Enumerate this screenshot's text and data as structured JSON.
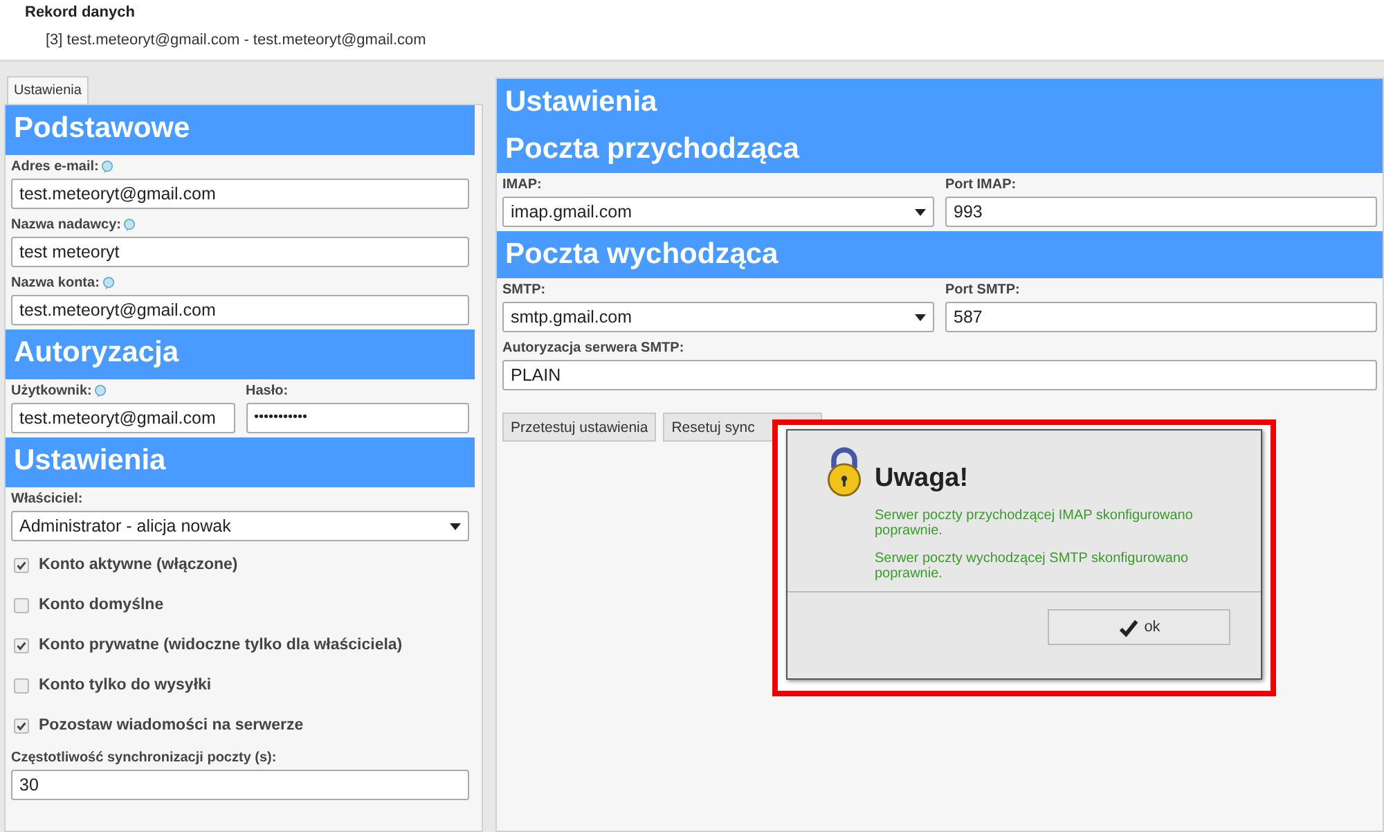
{
  "header": {
    "title": "Rekord danych",
    "subtitle": "[3] test.meteoryt@gmail.com - test.meteoryt@gmail.com"
  },
  "tabs": [
    {
      "label": "Ustawienia",
      "selected": true
    }
  ],
  "left_sections": [
    {
      "title": "Podstawowe",
      "fields": [
        {
          "kind": "text",
          "label": "Adres e-mail:",
          "info": true,
          "value": "test.meteoryt@gmail.com"
        },
        {
          "kind": "text",
          "label": "Nazwa nadawcy:",
          "info": true,
          "value": "test meteoryt"
        },
        {
          "kind": "text",
          "label": "Nazwa konta:",
          "info": true,
          "value": "test.meteoryt@gmail.com"
        }
      ]
    },
    {
      "title": "Autoryzacja",
      "fields": [
        {
          "kind": "pair",
          "items": [
            {
              "kind": "text",
              "label": "Użytkownik:",
              "info": true,
              "value": "test.meteoryt@gmail.com"
            },
            {
              "kind": "password",
              "label": "Hasło:",
              "info": false,
              "value": "•••••••••••"
            }
          ]
        }
      ]
    },
    {
      "title": "Ustawienia",
      "fields": [
        {
          "kind": "select",
          "label": "Właściciel:",
          "info": false,
          "value": "Administrator - alicja nowak"
        },
        {
          "kind": "checkbox",
          "label": "Konto aktywne (włączone)",
          "checked": true
        },
        {
          "kind": "checkbox",
          "label": "Konto domyślne",
          "checked": false
        },
        {
          "kind": "checkbox",
          "label": "Konto prywatne (widoczne tylko dla właściciela)",
          "checked": true
        },
        {
          "kind": "checkbox",
          "label": "Konto tylko do wysyłki",
          "checked": false
        },
        {
          "kind": "checkbox",
          "label": "Pozostaw wiadomości na serwerze",
          "checked": true
        },
        {
          "kind": "text",
          "label": "Częstotliwość synchronizacji poczty (s):",
          "info": false,
          "value": "30"
        }
      ]
    }
  ],
  "right_title": "Ustawienia",
  "right_sections": [
    {
      "title": "Poczta przychodząca",
      "fields": [
        {
          "kind": "pair",
          "items": [
            {
              "kind": "select",
              "label": "IMAP:",
              "info": false,
              "value": "imap.gmail.com"
            },
            {
              "kind": "text",
              "label": "Port IMAP:",
              "info": false,
              "value": "993"
            }
          ]
        }
      ]
    },
    {
      "title": "Poczta wychodząca",
      "fields": [
        {
          "kind": "pair",
          "items": [
            {
              "kind": "select",
              "label": "SMTP:",
              "info": false,
              "value": "smtp.gmail.com"
            },
            {
              "kind": "text",
              "label": "Port SMTP:",
              "info": false,
              "value": "587"
            }
          ]
        },
        {
          "kind": "text",
          "label": "Autoryzacja serwera SMTP:",
          "info": false,
          "value": "PLAIN"
        }
      ]
    }
  ],
  "buttons": [
    "Przetestuj ustawienia",
    "Resetuj sync"
  ],
  "dialog": {
    "title": "Uwaga!",
    "messages": [
      "Serwer poczty przychodzącej IMAP skonfigurowano poprawnie.",
      "Serwer poczty wychodzącej SMTP skonfigurowano poprawnie."
    ],
    "button": "ok"
  }
}
